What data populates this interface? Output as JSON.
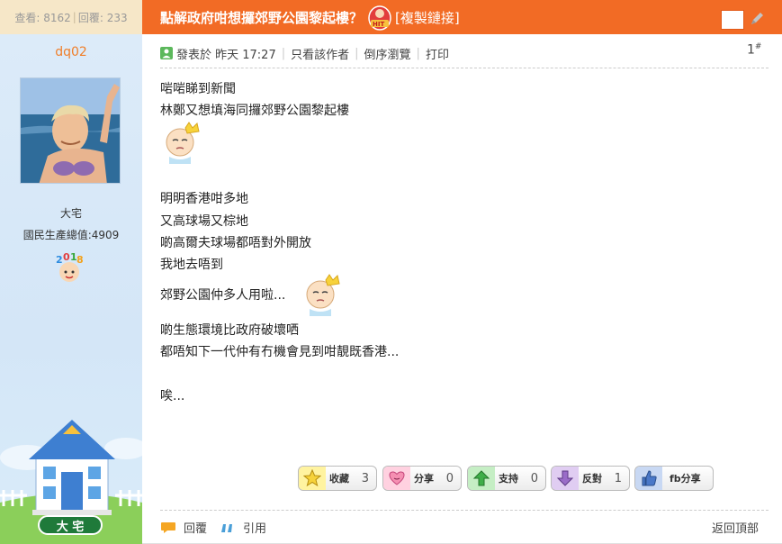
{
  "stats": {
    "views_label": "查看: 8162",
    "sep": "|",
    "replies_label": "回覆: 233"
  },
  "user": {
    "name": "dq02",
    "rank": "大宅",
    "gdp_label": "國民生產總值:4909",
    "badge_text": "大 宅"
  },
  "thread": {
    "title": "點解政府咁想攞郊野公園黎起樓？",
    "copy_link": "[複製鏈接]"
  },
  "post_meta": {
    "posted": "發表於 昨天 17:27",
    "only_author": "只看該作者",
    "reverse": "倒序瀏覽",
    "print": "打印",
    "floor": "1",
    "floor_sup": "#"
  },
  "post_body": {
    "l1": "啱啱睇到新聞",
    "l2": "林鄭又想填海同攞郊野公園黎起樓",
    "l3": "明明香港咁多地",
    "l4": "又高球場又棕地",
    "l5": "啲高爾夫球場都唔對外開放",
    "l6": "我地去唔到",
    "l7": "郊野公園仲多人用啦...",
    "l8": "啲生態環境比政府破壞哂",
    "l9": "都唔知下一代仲有冇機會見到咁靚既香港...",
    "l10": "唉..."
  },
  "reactions": {
    "favorite": {
      "label": "收藏",
      "count": "3"
    },
    "share": {
      "label": "分享",
      "count": "0"
    },
    "support": {
      "label": "支持",
      "count": "0"
    },
    "oppose": {
      "label": "反對",
      "count": "1"
    },
    "fb_share": {
      "label": "fb分享"
    }
  },
  "footer": {
    "reply": "回覆",
    "quote": "引用",
    "back_top": "返回頂部"
  },
  "colors": {
    "accent": "#f26b25",
    "sidebar_bg": "#d4e6f7",
    "username": "#f07f2a"
  },
  "icons": [
    "user-online-icon",
    "hit-logo-icon",
    "emoji-face-icon",
    "star-icon",
    "heart-icon",
    "up-arrow-icon",
    "down-arrow-icon",
    "thumbs-up-icon",
    "reply-icon",
    "quote-icon",
    "pen-icon"
  ]
}
